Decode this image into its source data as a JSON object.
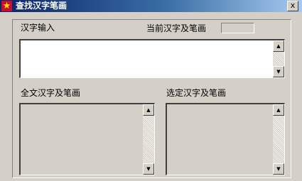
{
  "window": {
    "title": "查找汉字笔画",
    "icon": "star-icon",
    "close_label": "x"
  },
  "labels": {
    "hanzi_input": "汉字输入",
    "current_strokes": "当前汉字及笔画",
    "all_strokes": "全文汉字及笔画",
    "selected_strokes": "选定汉字及笔画"
  },
  "fields": {
    "hanzi_input_value": "",
    "current_strokes_value": "",
    "all_strokes_value": "",
    "selected_strokes_value": ""
  },
  "scroll_glyphs": {
    "up": "▲",
    "down": "▼"
  },
  "colors": {
    "title_gradient_start": "#0a246a",
    "title_gradient_end": "#a6caf0",
    "window_face": "#d4d0c8",
    "icon_red": "#c8102e",
    "icon_star": "#ffde00"
  }
}
